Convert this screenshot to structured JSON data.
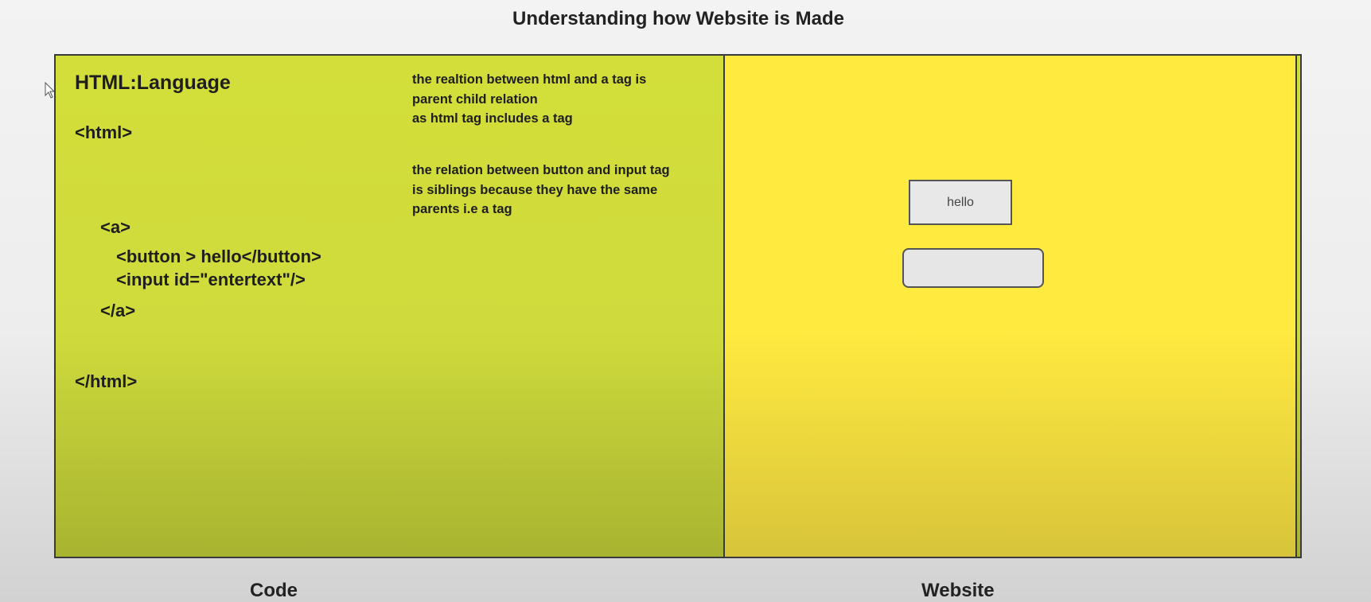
{
  "title": "Understanding how Website is Made",
  "code_panel": {
    "heading": "HTML:Language",
    "lines": {
      "html_open": "<html>",
      "a_open": "<a>",
      "button": "<button > hello</button>",
      "input": "<input id=\"entertext\"/>",
      "a_close": "</a>",
      "html_close": "</html>"
    },
    "note1": {
      "line1": "the realtion between html and a tag is",
      "line2": "parent child relation",
      "line3": "as html tag includes a tag"
    },
    "note2": {
      "line1": "the relation between button and input tag",
      "line2": "is siblings because they have the same",
      "line3": "parents i.e a tag"
    }
  },
  "website_panel": {
    "button_label": "hello",
    "input_value": ""
  },
  "captions": {
    "code": "Code",
    "website": "Website"
  },
  "icons": {
    "cursor": "mouse-pointer-icon"
  },
  "colors": {
    "code_bg": "#d3de3a",
    "website_bg": "#ffea3f"
  }
}
